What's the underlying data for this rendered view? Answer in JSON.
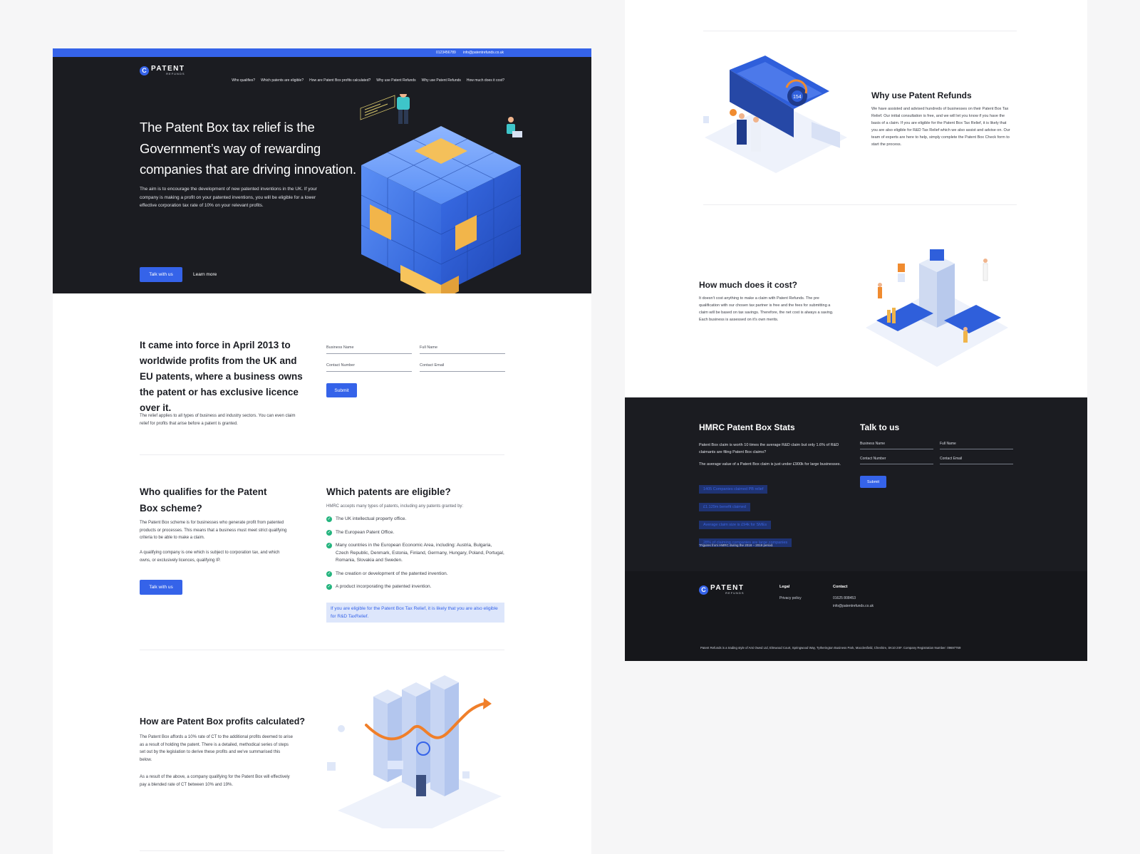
{
  "top_bar": {
    "phone": "0123456789",
    "email": "info@patentrefunds.co.uk"
  },
  "logo": {
    "mark": "C",
    "name": "PATENT",
    "sub": "REFUNDS"
  },
  "nav": {
    "items": [
      "Who qualifies?",
      "Which patents are eligible?",
      "How are Patent Box profits calculated?",
      "Why use Patent Refunds",
      "Why use Patent Refunds",
      "How much does it cost?"
    ]
  },
  "hero": {
    "title": "The Patent Box tax relief is the Government’s way of rewarding companies that are driving innovation.",
    "lead": "The aim is to encourage the development of new patented inventions in the UK. If your company is making a profit on your patented inventions, you will be eligible for a lower effective corporation tax rate of 10% on your relevant profits.",
    "primary_button": "Talk with us",
    "secondary_button": "Learn more"
  },
  "intro": {
    "title": "It came into force in April 2013 to worldwide profits from the UK and EU patents, where a business owns the patent or has exclusive licence over it.",
    "body": "The relief applies to all types of business and industry sectors. You can even claim relief for profits that arise before a patent is granted.",
    "form": {
      "business_name": "Business Name",
      "full_name": "Full Name",
      "contact_number": "Contact Number",
      "contact_email": "Contact Email",
      "submit": "Submit"
    }
  },
  "qualifies": {
    "title": "Who qualifies for the Patent Box scheme?",
    "p1": "The Patent Box scheme is for businesses who generate profit from patented products or processes. This means that a business must meet strict qualifying criteria to be able to make a claim.",
    "p2": "A qualifying company is one which is subject to corporation tax, and which owns, or exclusively licences, qualifying IP.",
    "button": "Talk with us"
  },
  "eligible": {
    "title": "Which patents are eligible?",
    "intro": "HMRC accepts many types of patents, including any patents granted by:",
    "items": [
      "The UK intellectual property office.",
      "The European Patent Office.",
      "Many countries in the European Economic Area, including: Austria, Bulgaria, Czech Republic, Denmark, Estonia, Finland, Germany, Hungary, Poland, Portugal, Romania, Slovakia and Sweden.",
      "The creation or development of the patented invention.",
      "A product incorporating the patented invention."
    ],
    "note": "If you are eligible for the Patent Box Tax Relief, it is likely that you are also eligible for R&D TaxRelief."
  },
  "calculated": {
    "title": "How are Patent Box profits calculated?",
    "p1": "The Patent Box affords a 10% rate of CT to the additional profits deemed to arise as a result of holding the patent.  There is a detailed, methodical series of steps set out by the legislation to derive these profits and we've summarised this below.",
    "p2": "As a result of the above, a company qualifying for the Patent Box will effectively pay a blended rate of CT between 10% and 19%."
  },
  "why": {
    "title": "Why use Patent Refunds",
    "body": "We have assisted and advised hundreds of businesses on their Patent Box Tax Relief. Our initial consultation is free, and we will let you know if you have the basis of a claim. If you are eligible for the Patent Box Tax Relief, it is likely that you are also eligible for R&D Tax Relief which we also assist and advise on. Our team of experts are here to help, simply complete the Patent Box Check form to start the process.",
    "illustration_label": "154"
  },
  "cost": {
    "title": "How much does it cost?",
    "body": "It doesn't cost anything to make a claim with Patent Refunds. The pre qualification with our chosen tax partner is free and the fees for submitting a claim will be based on tax savings. Therefore, the net cost is always a saving. Each business is assessed on it's own merits."
  },
  "stats": {
    "title": "HMRC Patent Box Stats",
    "p1": "Patent Box claim is worth 10 times the average R&D claim but only 1.6% of R&D claimants are filing Patent Box claims?",
    "p2": "The average value of a Patent Box claim is just under £900k for large businesses.",
    "tags": [
      "1405 Companies claimed PB relief",
      "£1.129m benefit claimed",
      "Average claim size is £94k for SMEs",
      "28% of claiming companies are large companies"
    ],
    "footnote": "*Figures from HMRC during the 2018 – 2019 period."
  },
  "talk": {
    "title": "Talk to us",
    "business_name": "Business Name",
    "full_name": "Full Name",
    "contact_number": "Contact Number",
    "contact_email": "Contact Email",
    "submit": "Submit"
  },
  "footer": {
    "legal_heading": "Legal",
    "privacy": "Privacy policy",
    "contact_heading": "Contact",
    "phone": "01625 808453",
    "email": "info@patentrefunds.co.uk",
    "legal_line": "Patent Refunds is a trading style of Ami Owed Ltd, Elmwood Court, Springwood Way, Tytherington Business Park, Macclesfield, Cheshire, SK10 2XF. Company Registration Number: 09697769"
  },
  "colors": {
    "accent": "#3563e9",
    "dark": "#1b1c21",
    "success": "#24b47e"
  }
}
